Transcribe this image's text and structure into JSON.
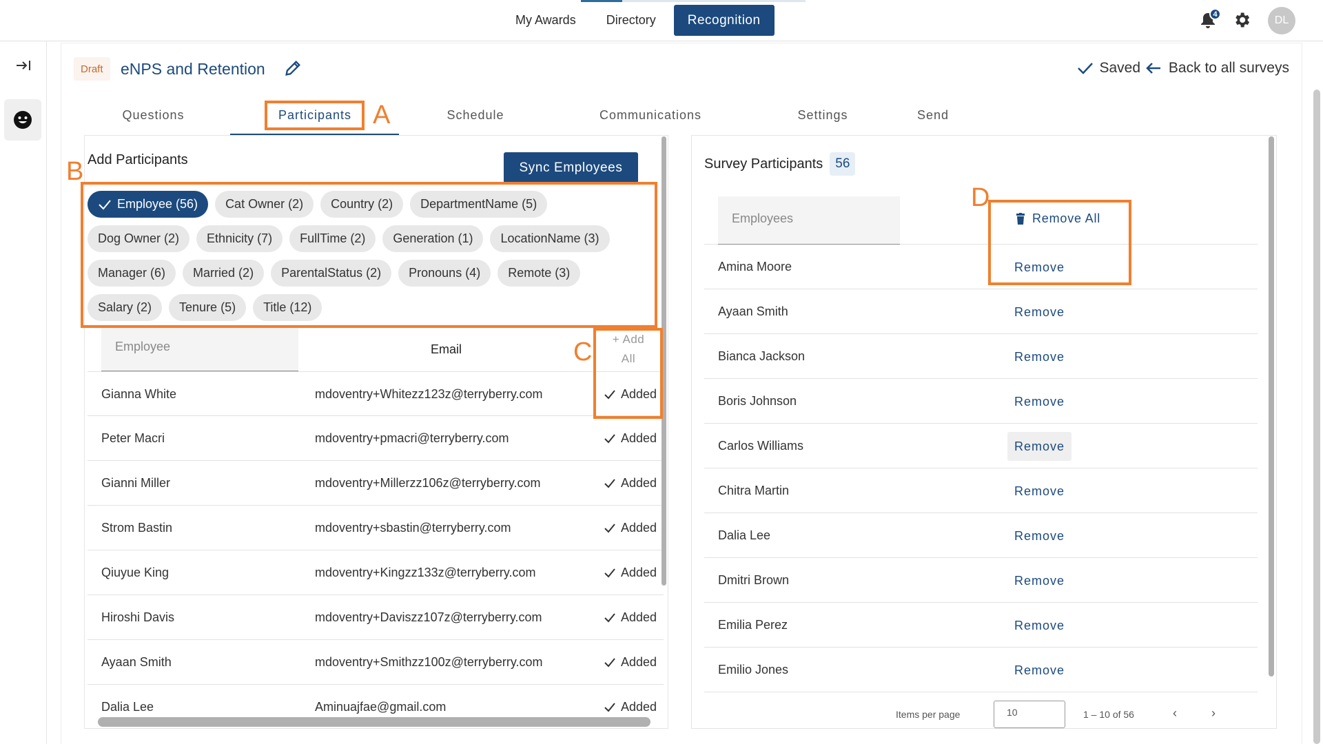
{
  "topnav": {
    "items": [
      {
        "label": "My Awards"
      },
      {
        "label": "Directory"
      },
      {
        "label": "Recognition",
        "active": true
      }
    ],
    "notification_count": "4",
    "avatar_initials": "DL",
    "icons": [
      "bell-icon",
      "gear-icon"
    ]
  },
  "sidebar": {
    "icons": [
      "expand-arrow-icon",
      "smiley-icon"
    ]
  },
  "header": {
    "status": "Draft",
    "title": "eNPS and Retention",
    "saved_label": "Saved",
    "back_label": "Back to all surveys"
  },
  "tabs": [
    {
      "label": "Questions"
    },
    {
      "label": "Participants",
      "active": true
    },
    {
      "label": "Schedule"
    },
    {
      "label": "Communications"
    },
    {
      "label": "Settings"
    },
    {
      "label": "Send"
    }
  ],
  "annotations": {
    "a": "A",
    "b": "B",
    "c": "C",
    "d": "D",
    "color": "#f07f2f"
  },
  "add_participants": {
    "title": "Add Participants",
    "sync_label": "Sync Employees",
    "chips": [
      [
        "Employee (56)",
        "Cat Owner (2)",
        "Country (2)",
        "DepartmentName (5)"
      ],
      [
        "Dog Owner (2)",
        "Ethnicity (7)",
        "FullTime (2)",
        "Generation (1)",
        "LocationName (3)"
      ],
      [
        "Manager (6)",
        "Married (2)",
        "ParentalStatus (2)",
        "Pronouns (4)",
        "Remote (3)"
      ],
      [
        "Salary (2)",
        "Tenure (5)",
        "Title (12)"
      ]
    ],
    "selected_chip": "Employee (56)",
    "table": {
      "employee_placeholder": "Employee",
      "email_header": "Email",
      "add_all_line1": "+ Add",
      "add_all_line2": "All",
      "added_label": "Added",
      "rows": [
        {
          "name": "Gianna White",
          "email": "mdoventry+Whitezz123z@terryberry.com"
        },
        {
          "name": "Peter Macri",
          "email": "mdoventry+pmacri@terryberry.com"
        },
        {
          "name": "Gianni Miller",
          "email": "mdoventry+Millerzz106z@terryberry.com"
        },
        {
          "name": "Strom Bastin",
          "email": "mdoventry+sbastin@terryberry.com"
        },
        {
          "name": "Qiuyue King",
          "email": "mdoventry+Kingzz133z@terryberry.com"
        },
        {
          "name": "Hiroshi Davis",
          "email": "mdoventry+Daviszz107z@terryberry.com"
        },
        {
          "name": "Ayaan Smith",
          "email": "mdoventry+Smithzz100z@terryberry.com"
        },
        {
          "name": "Dalia Lee",
          "email": "Aminuajfae@gmail.com"
        }
      ]
    }
  },
  "survey_participants": {
    "title": "Survey Participants",
    "count": "56",
    "employees_placeholder": "Employees",
    "remove_all_label": "Remove All",
    "remove_label": "Remove",
    "rows": [
      "Amina Moore",
      "Ayaan Smith",
      "Bianca Jackson",
      "Boris Johnson",
      "Carlos Williams",
      "Chitra Martin",
      "Dalia Lee",
      "Dmitri Brown",
      "Emilia Perez",
      "Emilio Jones"
    ],
    "pager": {
      "items_per_page_label": "Items per page",
      "items_per_page": "10",
      "range": "1 – 10 of 56"
    }
  },
  "colors": {
    "brand": "#1c4a7e",
    "annotation": "#f07f2f",
    "draft": "#c56a2f"
  }
}
